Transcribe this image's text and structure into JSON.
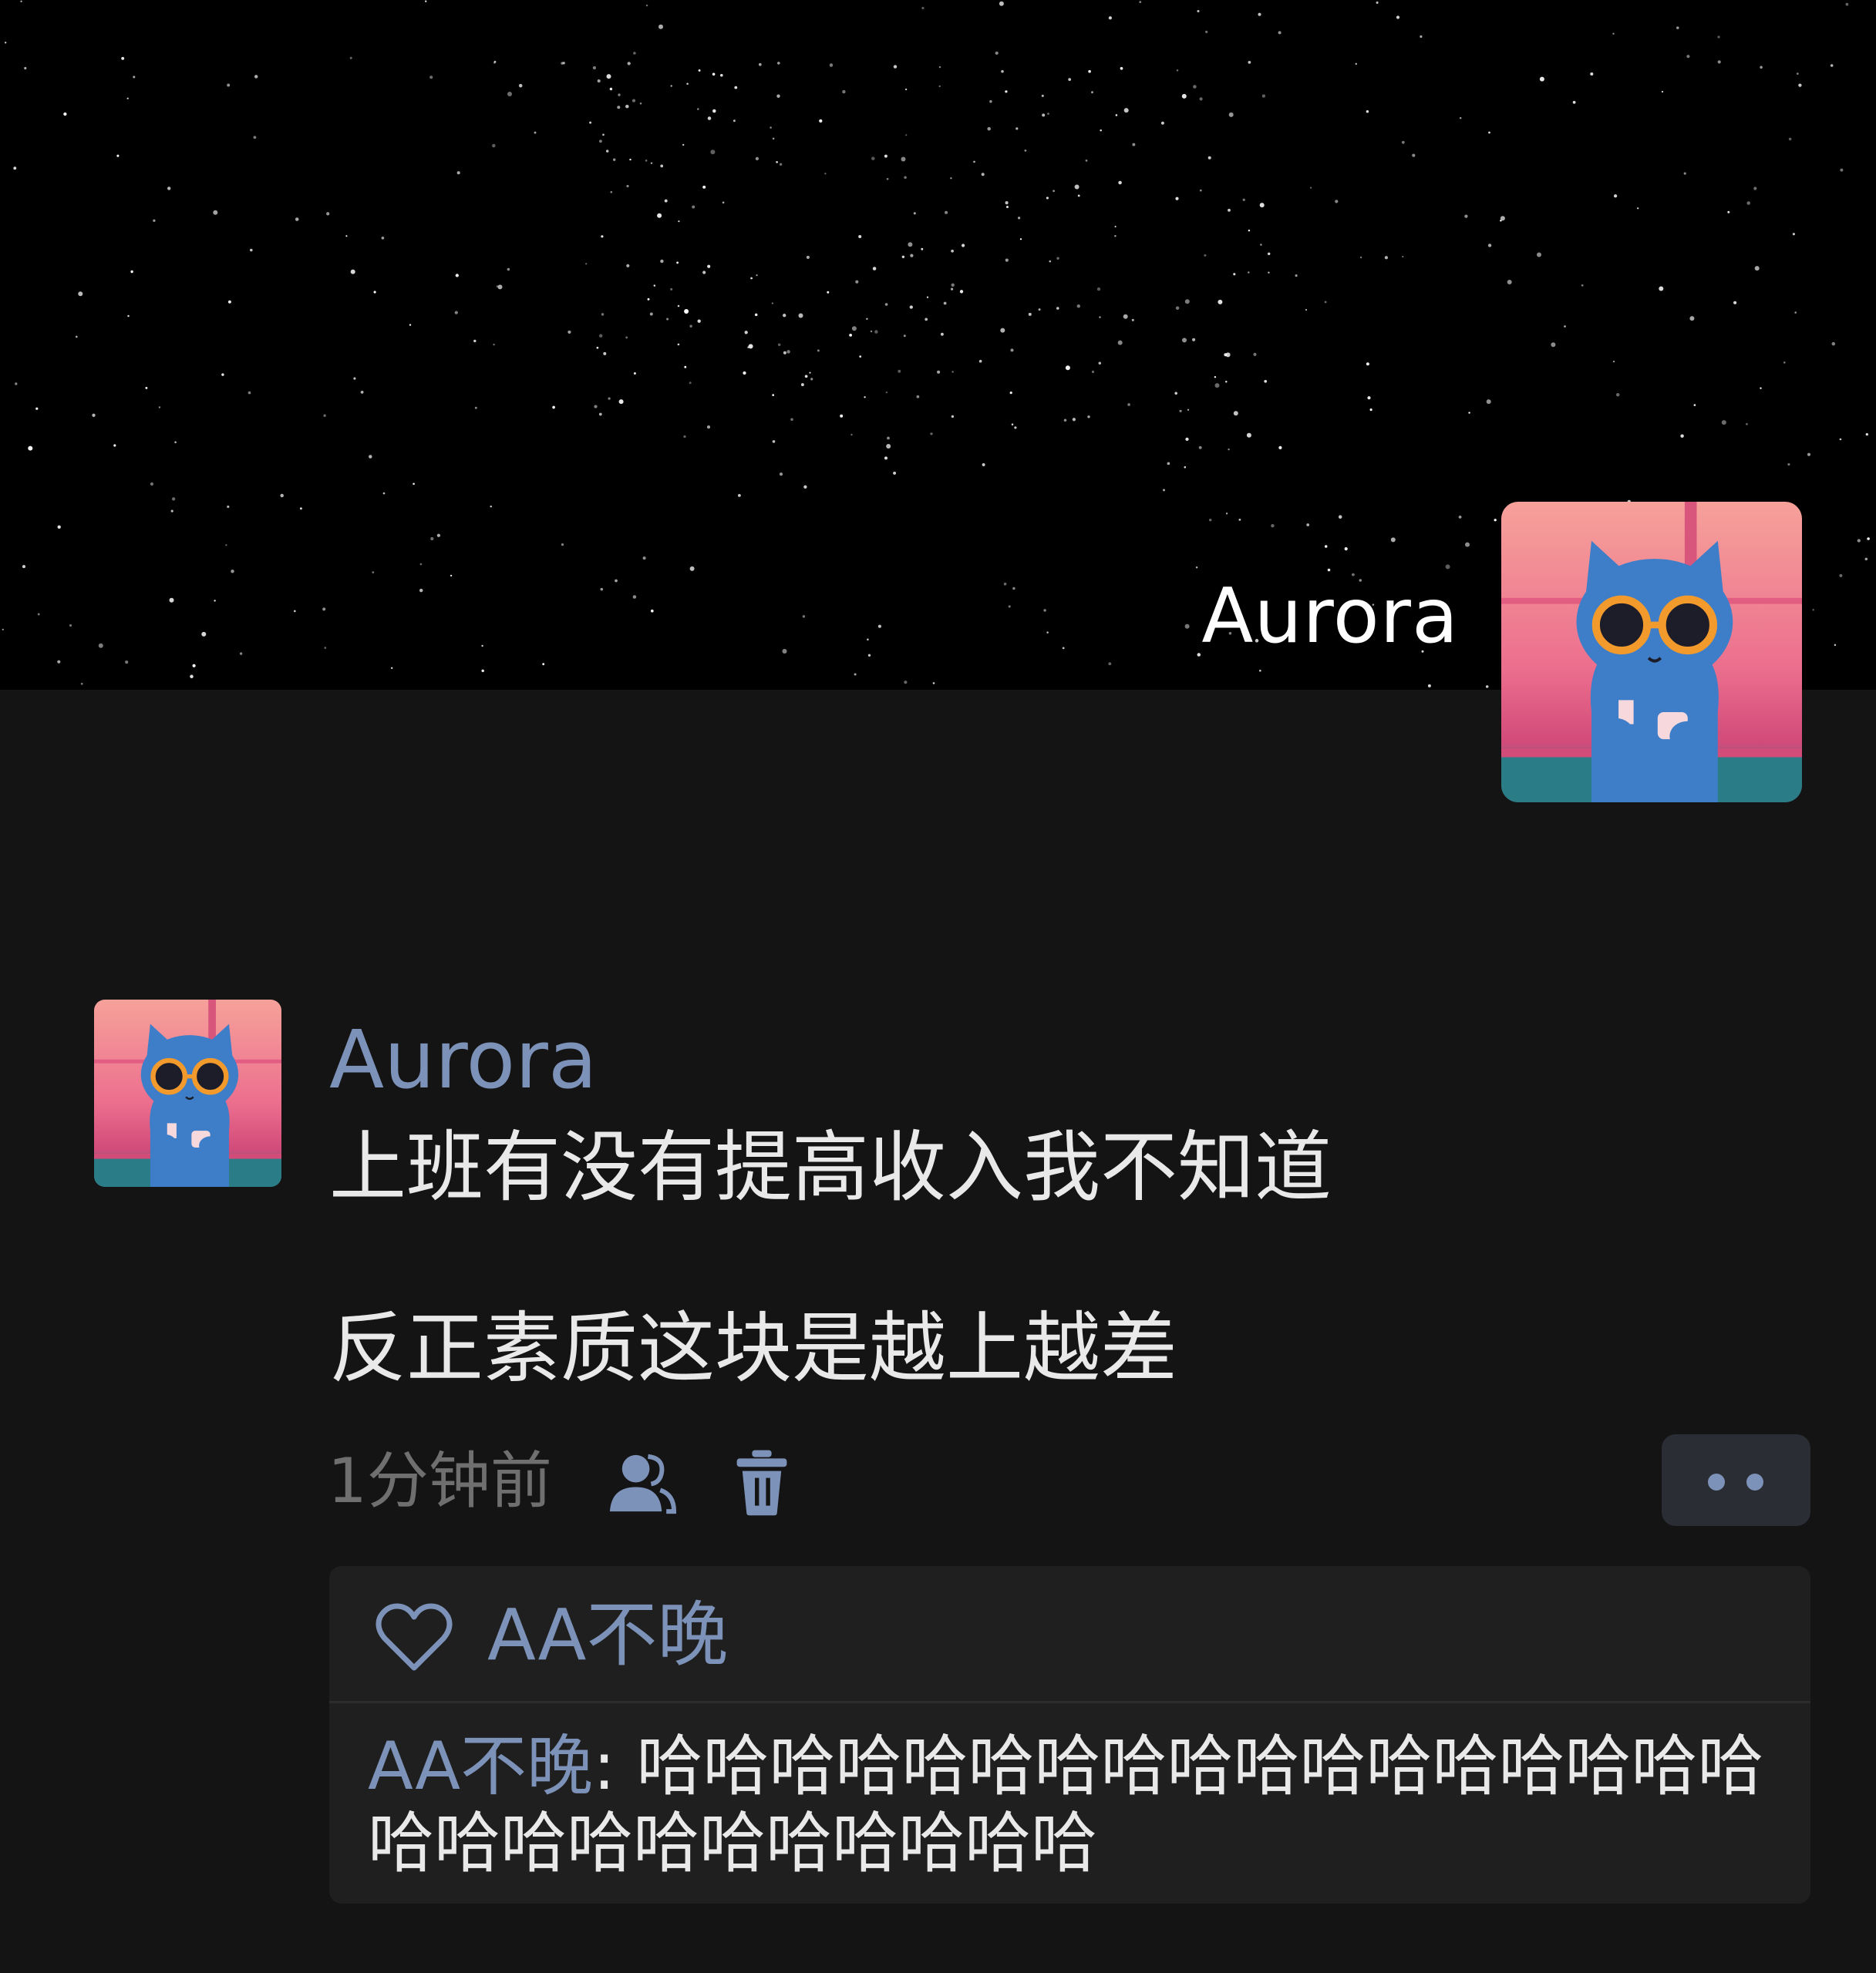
{
  "cover": {
    "user_name": "Aurora",
    "avatar_icon": "cat-sunglasses-avatar"
  },
  "post": {
    "author": "Aurora",
    "avatar_icon": "cat-sunglasses-avatar",
    "content_line1": "上班有没有提高收入我不知道",
    "content_line2": "反正素质这块是越上越差",
    "time": "1分钟前",
    "visibility_icon": "friends-icon",
    "delete_icon": "trash-icon",
    "more_icon": "more-dots-icon"
  },
  "interactions": {
    "likes": [
      "AA不晚"
    ],
    "comments": [
      {
        "name": "AA不晚",
        "separator": ": ",
        "text": "哈哈哈哈哈哈哈哈哈哈哈哈哈哈哈哈哈哈哈哈哈哈哈哈哈哈哈哈"
      }
    ]
  },
  "colors": {
    "cover_bg": "#000000",
    "page_bg": "#141414",
    "name_blue": "#7d92b8",
    "text": "#e9e9e9",
    "meta_gray": "#6f6f6f",
    "panel_bg": "#1f1f1f"
  }
}
